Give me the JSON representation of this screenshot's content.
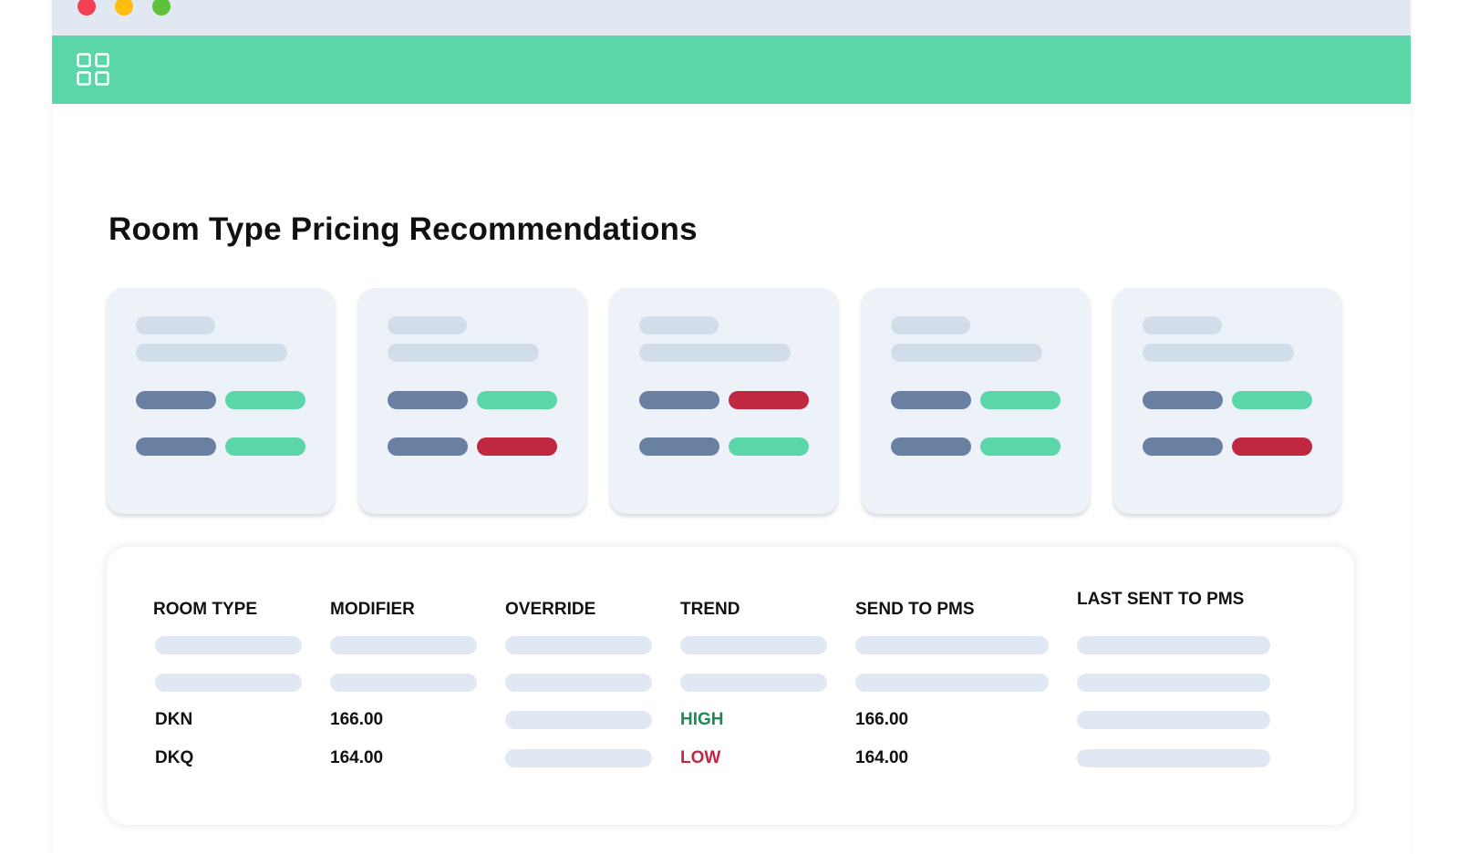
{
  "colors": {
    "accent": "#5ad6a8",
    "negative": "#c0283f",
    "neutral_pill": "#6a80a2",
    "trend_high": "#1e8a52",
    "trend_low": "#c0283f"
  },
  "appbar": {
    "icon": "grid-icon"
  },
  "page": {
    "title": "Room Type Pricing Recommendations"
  },
  "cards": [
    {
      "row1_status": "positive",
      "row2_status": "positive"
    },
    {
      "row1_status": "positive",
      "row2_status": "negative"
    },
    {
      "row1_status": "negative",
      "row2_status": "positive"
    },
    {
      "row1_status": "positive",
      "row2_status": "positive"
    },
    {
      "row1_status": "positive",
      "row2_status": "negative"
    }
  ],
  "table": {
    "headers": {
      "room_type": "ROOM TYPE",
      "modifier": "MODIFIER",
      "override": "OVERRIDE",
      "trend": "TREND",
      "send_to_pms": "SEND TO PMS",
      "last_sent_to_pms": "LAST SENT TO PMS"
    },
    "rows": [
      {
        "room_type": "DKN",
        "modifier": "166.00",
        "trend": "HIGH",
        "send_to_pms": "166.00"
      },
      {
        "room_type": "DKQ",
        "modifier": "164.00",
        "trend": "LOW",
        "send_to_pms": "164.00"
      }
    ]
  }
}
